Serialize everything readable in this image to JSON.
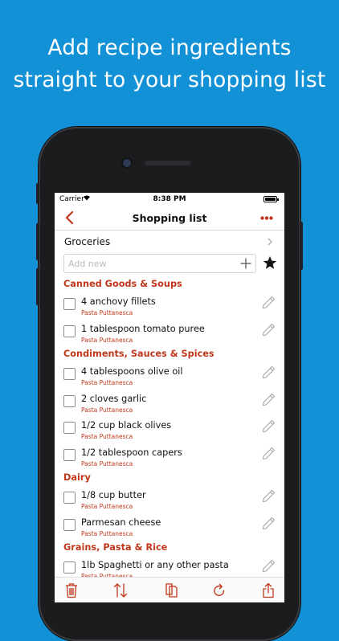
{
  "headline": {
    "line1": "Add recipe ingredients",
    "line2": "straight to your shopping list"
  },
  "status_bar": {
    "carrier": "Carrier",
    "time": "8:38 PM"
  },
  "nav": {
    "title": "Shopping list"
  },
  "list_selector": {
    "name": "Groceries"
  },
  "add_new": {
    "placeholder": "Add new",
    "value": ""
  },
  "sections": [
    {
      "title": "Canned Goods & Soups",
      "items": [
        {
          "name": "4 anchovy fillets",
          "recipe": "Pasta Puttanesca"
        },
        {
          "name": "1 tablespoon tomato puree",
          "recipe": "Pasta Puttanesca"
        }
      ]
    },
    {
      "title": "Condiments, Sauces & Spices",
      "items": [
        {
          "name": "4 tablespoons olive oil",
          "recipe": "Pasta Puttanesca"
        },
        {
          "name": "2 cloves garlic",
          "recipe": "Pasta Puttanesca"
        },
        {
          "name": "1/2 cup black olives",
          "recipe": "Pasta Puttanesca"
        },
        {
          "name": "1/2 tablespoon capers",
          "recipe": "Pasta Puttanesca"
        }
      ]
    },
    {
      "title": "Dairy",
      "items": [
        {
          "name": "1/8 cup butter",
          "recipe": "Pasta Puttanesca"
        },
        {
          "name": "Parmesan cheese",
          "recipe": "Pasta Puttanesca"
        }
      ]
    },
    {
      "title": "Grains, Pasta & Rice",
      "items": [
        {
          "name": "1lb Spaghetti or any other pasta",
          "recipe": "Pasta Puttanesca"
        }
      ]
    }
  ],
  "icons": {
    "back": "chevron-left-icon",
    "more": "more-dots-icon",
    "chevron": "chevron-right-icon",
    "add": "plus-icon",
    "favorite": "star-icon",
    "edit": "pencil-icon",
    "trash": "trash-icon",
    "sort": "sort-arrows-icon",
    "copy": "copy-icon",
    "refresh": "refresh-icon",
    "share": "share-icon"
  },
  "colors": {
    "background": "#1391d6",
    "accent": "#c0371b"
  }
}
